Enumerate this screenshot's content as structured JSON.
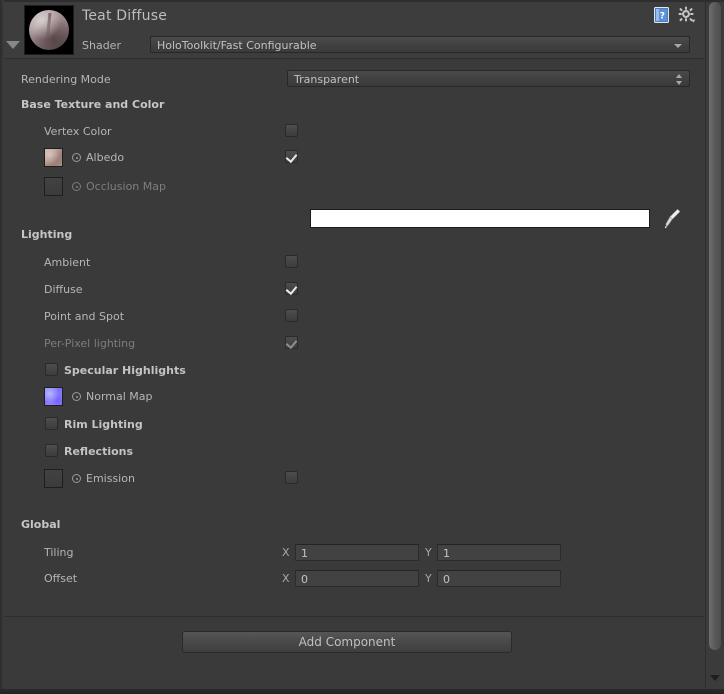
{
  "window": {
    "scrollbar_present": true
  },
  "material_header": {
    "title": "Teat Diffuse",
    "shader_label": "Shader",
    "shader_value": "HoloToolkit/Fast Configurable",
    "help_icon": "help-book-icon",
    "gear_icon": "gear-icon",
    "foldout_icon": "foldout-triangle-down-icon",
    "preview_name": "material-preview-sphere"
  },
  "rendering_mode": {
    "label": "Rendering Mode",
    "value": "Transparent"
  },
  "sections": {
    "base_texture": {
      "title": "Base Texture and Color",
      "rows": [
        {
          "label": "Vertex Color",
          "checked": false,
          "dim": false,
          "bold": false
        },
        {
          "label": "Albedo",
          "checked": true,
          "dim": false,
          "bold": false
        },
        {
          "label": "Occlusion Map",
          "checked": false,
          "dim": true,
          "bold": false
        }
      ],
      "albedo_color": "#ffffff",
      "eyedropper_icon": "eyedropper-icon",
      "albedo_texture": "albedo-texture-thumbnail",
      "occlusion_texture": "occlusion-texture-thumbnail"
    },
    "lighting": {
      "title": "Lighting",
      "rows": [
        {
          "label": "Ambient",
          "checked": false
        },
        {
          "label": "Diffuse",
          "checked": true
        },
        {
          "label": "Point and Spot",
          "checked": false
        },
        {
          "label": "Per-Pixel lighting",
          "checked": true,
          "dim": true
        }
      ],
      "toggles": [
        {
          "label": "Specular Highlights",
          "checked": false
        },
        {
          "label": "Normal Map",
          "texture": "normal-map-thumbnail"
        },
        {
          "label": "Rim Lighting",
          "checked": false
        },
        {
          "label": "Reflections",
          "checked": false
        },
        {
          "label": "Emission",
          "checked": false,
          "texture": "emission-texture-thumbnail"
        }
      ]
    },
    "global": {
      "title": "Global",
      "tiling": {
        "label": "Tiling",
        "x_axis": "X",
        "x": "1",
        "y_axis": "Y",
        "y": "1"
      },
      "offset": {
        "label": "Offset",
        "x_axis": "X",
        "x": "0",
        "y_axis": "Y",
        "y": "0"
      }
    }
  },
  "bottom": {
    "add_component_label": "Add Component"
  },
  "colors": {
    "panel_bg": "#3a3a3a",
    "header_bg": "#3d3d3d",
    "text": "#b6b6b6",
    "text_dim": "#7e7e7e",
    "text_bold": "#c6c6c6",
    "help_icon_blue": "#3f6fb5",
    "normal_map_purple": "#8f8bfb"
  }
}
